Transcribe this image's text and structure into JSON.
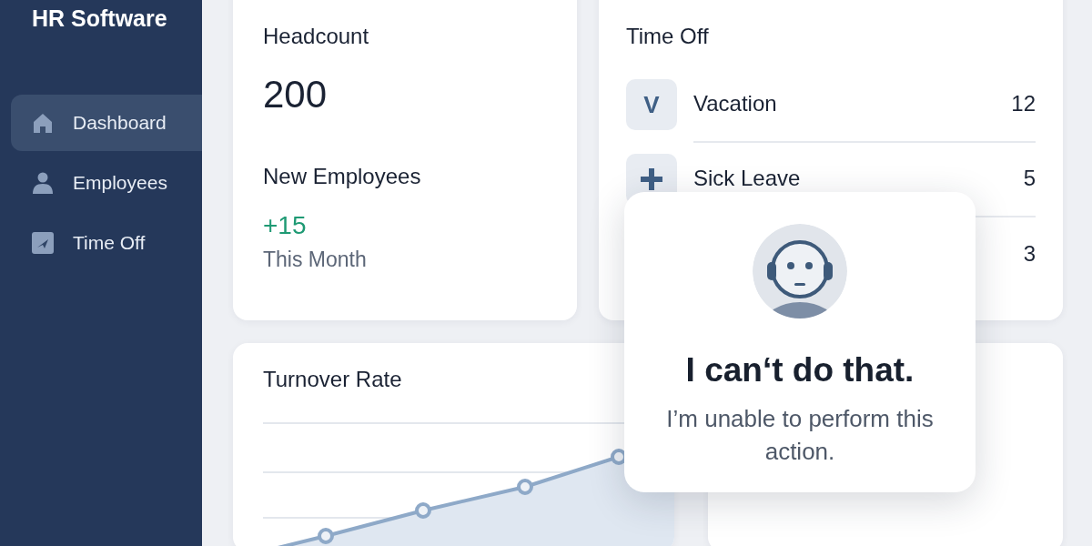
{
  "sidebar": {
    "title": "HR Software",
    "items": [
      {
        "label": "Dashboard",
        "kind": "home",
        "selected": true
      },
      {
        "label": "Employees",
        "kind": "person",
        "selected": false
      },
      {
        "label": "Time Off",
        "kind": "calendar",
        "selected": false
      }
    ]
  },
  "headcount": {
    "title": "Headcount",
    "value": "200",
    "new_title": "New Employees",
    "new_value": "+15",
    "new_caption": "This Month"
  },
  "time_off": {
    "title": "Time Off",
    "items": [
      {
        "kind": "letter",
        "icon_text": "V",
        "label": "Vacation",
        "count": "12"
      },
      {
        "kind": "plus",
        "label": "Sick Leave",
        "count": "5"
      },
      {
        "count": "3"
      }
    ]
  },
  "turnover": {
    "title": "Turnover Rate"
  },
  "dialog": {
    "title": "I can‘t do that.",
    "message": "I’m unable to perform this action."
  }
}
